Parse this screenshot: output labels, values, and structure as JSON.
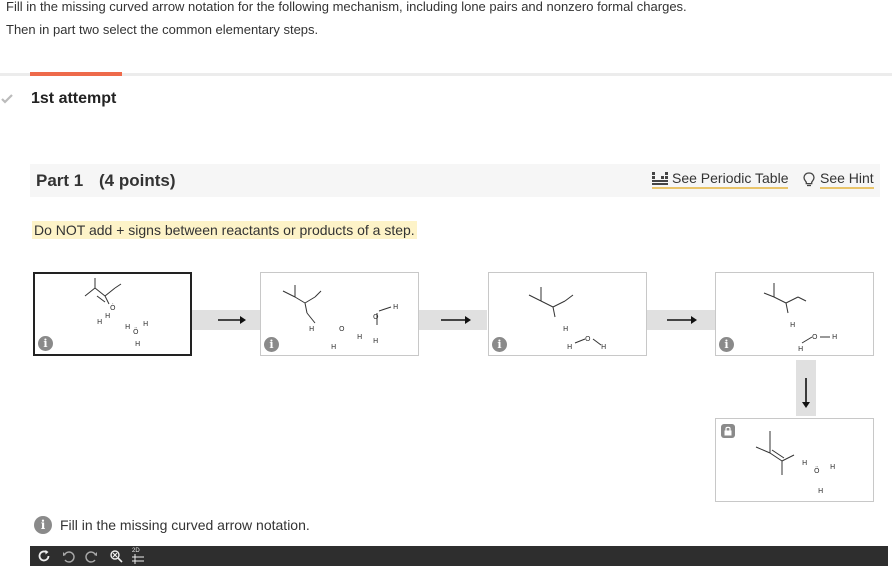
{
  "instructions": {
    "line1": "Fill in the missing curved arrow notation for the following mechanism, including lone pairs and nonzero formal charges.",
    "line2": "Then in part two select the common elementary steps."
  },
  "attempt": {
    "label": "1st attempt"
  },
  "part": {
    "title": "Part 1",
    "points": "(4 points)",
    "periodic_label": "See Periodic Table",
    "hint_label": "See Hint"
  },
  "warning": "Do NOT add + signs between reactants or products of a step.",
  "steps": [
    {
      "name": "step-1",
      "selected": true,
      "badge": "i"
    },
    {
      "name": "step-2",
      "selected": false,
      "badge": "i"
    },
    {
      "name": "step-3",
      "selected": false,
      "badge": "i"
    },
    {
      "name": "step-4",
      "selected": false,
      "badge": "i"
    },
    {
      "name": "step-5",
      "selected": false,
      "badge": "lock"
    }
  ],
  "fill_note": "Fill in the missing curved arrow notation.",
  "toolbar": {
    "icons": [
      "refresh-icon",
      "undo-icon",
      "redo-icon",
      "zoom-icon",
      "2d-view-icon"
    ],
    "view_label": "2D"
  },
  "colors": {
    "accent": "#ee6a4b",
    "link_underline": "#e9c46a",
    "warning_bg": "#fdf3c8",
    "toolbar_bg": "#2e2e2e"
  }
}
